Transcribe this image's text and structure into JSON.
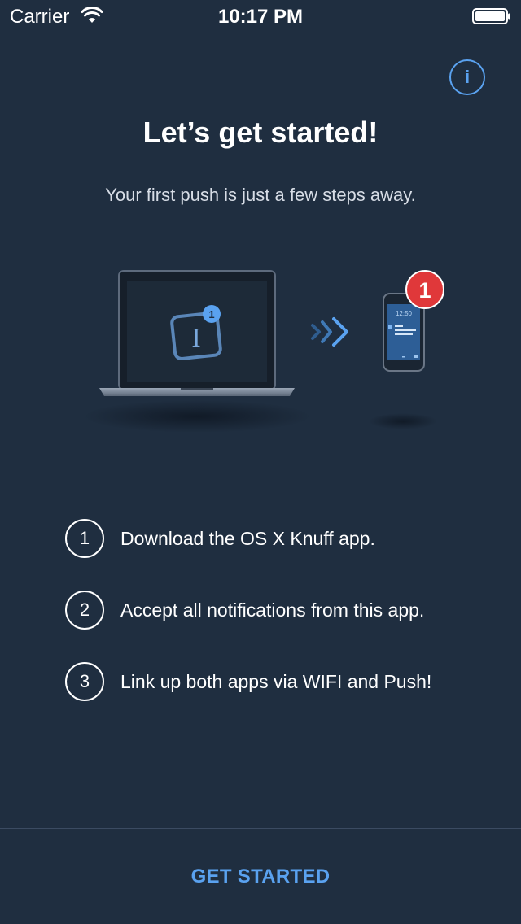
{
  "status_bar": {
    "carrier": "Carrier",
    "time": "10:17 PM"
  },
  "info_button": {
    "label": "i"
  },
  "header": {
    "title": "Let’s get started!",
    "subtitle": "Your first push is just a few steps away."
  },
  "illustration": {
    "laptop_badge": "1",
    "laptop_app_glyph": "I",
    "phone_badge": "1",
    "phone_time": "12:50"
  },
  "steps": [
    {
      "number": "1",
      "text": "Download the OS X Knuff app."
    },
    {
      "number": "2",
      "text": "Accept all notifications from this app."
    },
    {
      "number": "3",
      "text": "Link up both apps via WIFI and Push!"
    }
  ],
  "footer": {
    "button_label": "GET STARTED"
  },
  "colors": {
    "background": "#1f2e40",
    "accent": "#5aa2f0",
    "badge_red": "#e0383a",
    "divider": "#3b4b62"
  },
  "icons": {
    "wifi": "wifi-icon",
    "battery": "battery-icon",
    "info": "info-icon",
    "laptop": "laptop-icon",
    "phone": "phone-icon",
    "arrows": "double-chevron-right-icon"
  }
}
